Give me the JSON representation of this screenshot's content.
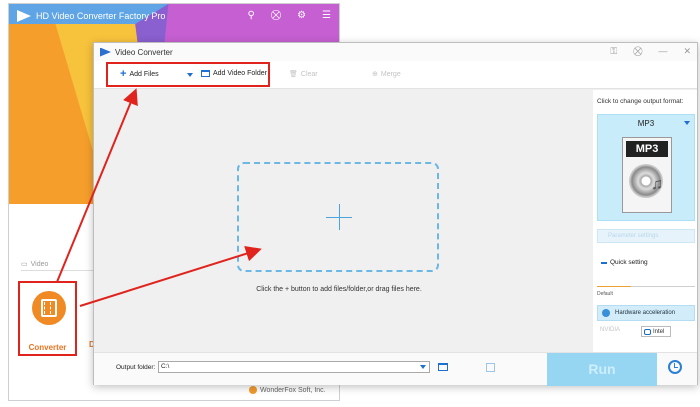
{
  "background_window": {
    "title": "HD Video Converter Factory Pro",
    "tab_video_label": "Video",
    "converter_label": "Converter",
    "second_item_letter": "D",
    "footer": "WonderFox Soft, Inc."
  },
  "main_window": {
    "title": "Video Converter",
    "toolbar": {
      "add_files": "Add Files",
      "add_video_folder": "Add Video Folder",
      "clear": "Clear",
      "merge": "Merge"
    },
    "drop_hint": "Click the + button to add files/folder,or drag files here.",
    "right_panel": {
      "change_format_label": "Click to change output format:",
      "format_name": "MP3",
      "format_icon_text": "MP3",
      "parameter_settings": "Parameter settings",
      "quick_setting": "Quick setting",
      "slider_default": "Default",
      "hardware_acceleration": "Hardware acceleration",
      "nvidia": "NVIDIA",
      "intel": "Intel"
    },
    "bottom": {
      "output_folder_label": "Output folder:",
      "output_folder_value": "C:\\",
      "run": "Run"
    }
  },
  "colors": {
    "highlight_red": "#e0241d",
    "accent_blue": "#1e6fd2",
    "converter_orange": "#f08a24",
    "run_button": "#97d6f2"
  }
}
